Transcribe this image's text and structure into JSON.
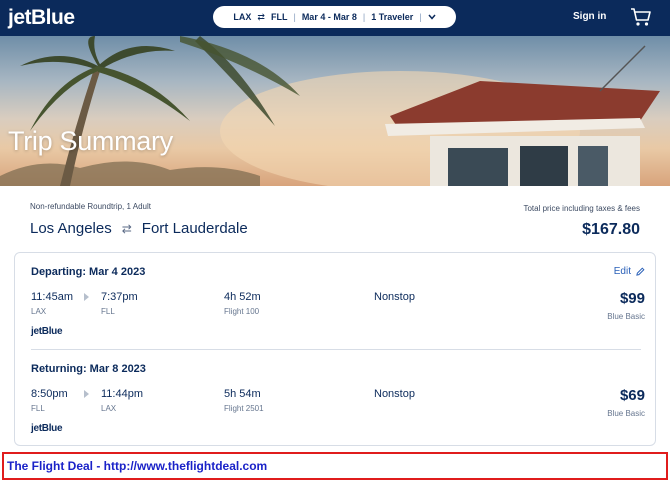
{
  "nav": {
    "logo": "jetBlue",
    "search": {
      "origin": "LAX",
      "swap_icon": "⇄",
      "destination": "FLL",
      "dates": "Mar 4 - Mar 8",
      "travelers": "1 Traveler",
      "dropdown_icon": "chevron-down-icon"
    },
    "sign_in": "Sign in",
    "cart_icon": "cart-icon"
  },
  "hero": {
    "title": "Trip Summary"
  },
  "summary": {
    "trip_meta": "Non-refundable Roundtrip, 1 Adult",
    "origin_city": "Los Angeles",
    "swap_icon": "⇄",
    "destination_city": "Fort Lauderdale",
    "total_label": "Total price including taxes & fees",
    "total_price": "$167.80"
  },
  "legs": {
    "depart": {
      "title": "Departing: Mar 4 2023",
      "edit_label": "Edit",
      "dep_time": "11:45am",
      "dep_code": "LAX",
      "arr_time": "7:37pm",
      "arr_code": "FLL",
      "duration": "4h 52m",
      "flight": "Flight 100",
      "stops": "Nonstop",
      "price": "$99",
      "fare_class": "Blue Basic",
      "airline": "jetBlue"
    },
    "return": {
      "title": "Returning: Mar 8 2023",
      "dep_time": "8:50pm",
      "dep_code": "FLL",
      "arr_time": "11:44pm",
      "arr_code": "LAX",
      "duration": "5h 54m",
      "flight": "Flight 2501",
      "stops": "Nonstop",
      "price": "$69",
      "fare_class": "Blue Basic",
      "airline": "jetBlue"
    }
  },
  "credit": {
    "text": "The Flight Deal - http://www.theflightdeal.com"
  },
  "colors": {
    "navy": "#0b2a5b",
    "link_blue": "#2a60b8",
    "credit_red": "#e01c1c",
    "credit_text": "#1a22c8"
  }
}
